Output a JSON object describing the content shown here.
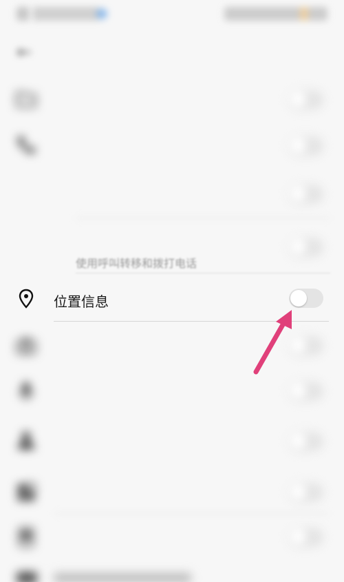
{
  "status_bar": {
    "left_text": "",
    "right_text": ""
  },
  "header": {
    "back_icon": "arrow-left-icon",
    "title": ""
  },
  "rows": [
    {
      "id": "storage",
      "icon": "folder-icon",
      "label": "",
      "enabled": false
    },
    {
      "id": "phone",
      "icon": "phone-icon",
      "label": "",
      "enabled": false
    },
    {
      "id": "phone-sub-1",
      "label": "",
      "subtitle": "",
      "enabled": false
    },
    {
      "id": "phone-sub-2",
      "label": "",
      "subtitle": "使用呼叫转移和拨打电话",
      "enabled": false
    },
    {
      "id": "camera",
      "icon": "camera-icon",
      "label": "",
      "enabled": false
    },
    {
      "id": "microphone",
      "icon": "microphone-icon",
      "label": "",
      "enabled": false
    },
    {
      "id": "contacts",
      "icon": "contacts-icon",
      "label": "",
      "subtitle": "",
      "enabled": false
    },
    {
      "id": "apps",
      "icon": "apps-icon",
      "label": "",
      "enabled": false
    },
    {
      "id": "sms",
      "icon": "sms-icon",
      "label": "",
      "enabled": false
    }
  ],
  "location": {
    "icon": "location-pin-icon",
    "label": "位置信息",
    "enabled": false
  },
  "colors": {
    "arrow": "#e0407a",
    "switch_off": "#e4e4e4",
    "background": "#f7f7f7"
  }
}
